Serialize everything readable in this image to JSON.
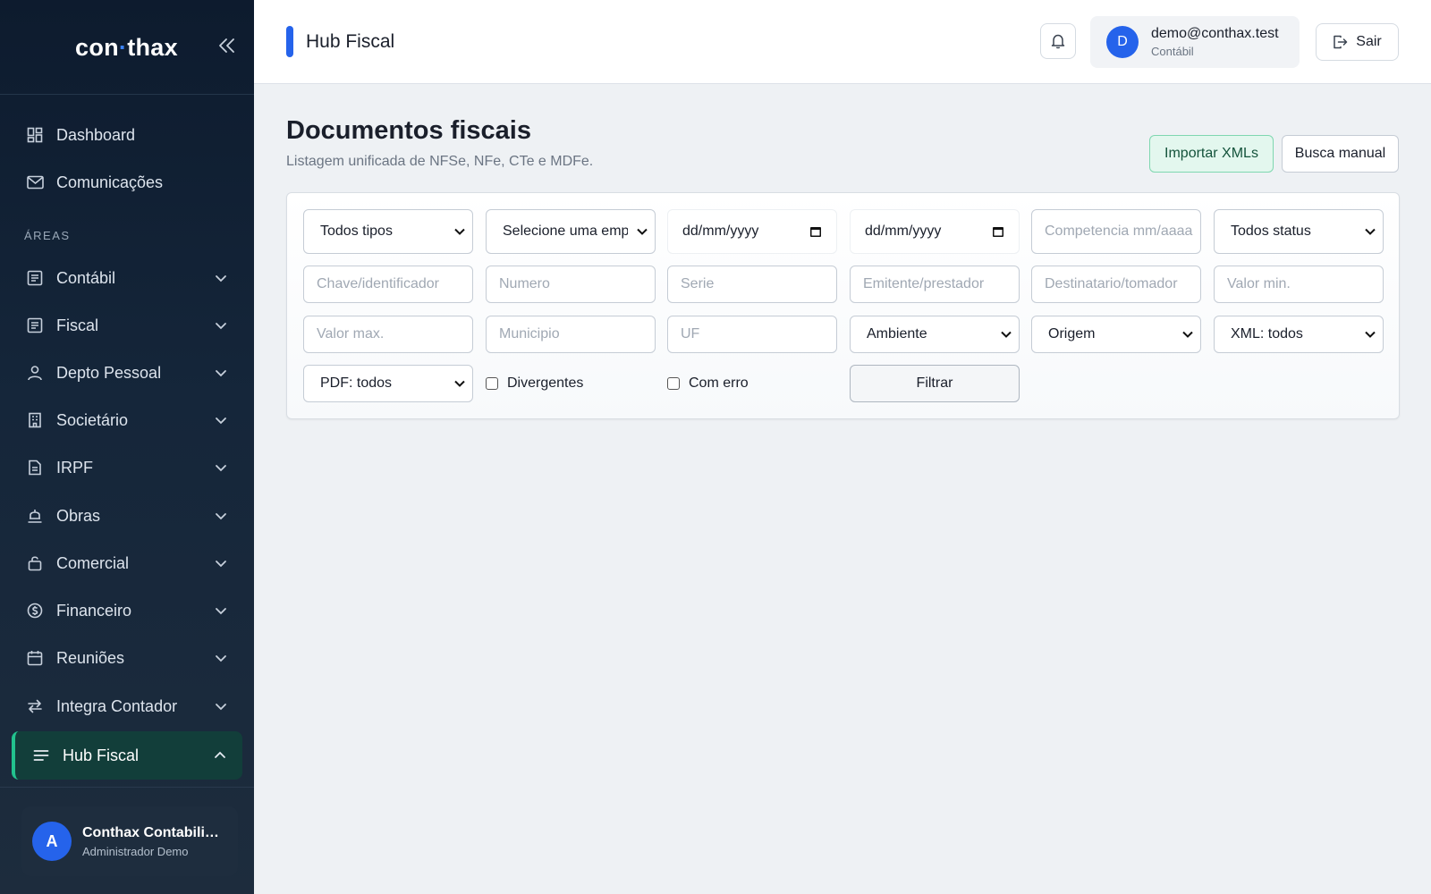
{
  "sidebar": {
    "brand": {
      "part1": "con",
      "dot": "·",
      "part2": "thax"
    },
    "top_items": [
      {
        "label": "Dashboard",
        "icon": "dashboard-icon"
      },
      {
        "label": "Comunicações",
        "icon": "mail-icon"
      }
    ],
    "section_label": "ÁREAS",
    "areas": [
      {
        "label": "Contábil",
        "icon": "ledger-icon"
      },
      {
        "label": "Fiscal",
        "icon": "ledger-icon"
      },
      {
        "label": "Depto Pessoal",
        "icon": "user-icon"
      },
      {
        "label": "Societário",
        "icon": "building-icon"
      },
      {
        "label": "IRPF",
        "icon": "document-icon"
      },
      {
        "label": "Obras",
        "icon": "construction-icon"
      },
      {
        "label": "Comercial",
        "icon": "bag-icon"
      },
      {
        "label": "Financeiro",
        "icon": "coin-icon"
      },
      {
        "label": "Reuniões",
        "icon": "calendar-icon"
      },
      {
        "label": "Integra Contador",
        "icon": "swap-icon"
      }
    ],
    "active_item": {
      "label": "Hub Fiscal",
      "icon": "list-icon"
    },
    "user": {
      "initial": "A",
      "name": "Conthax Contabilidade",
      "role": "Administrador Demo"
    }
  },
  "header": {
    "title": "Hub Fiscal",
    "user": {
      "initial": "D",
      "email": "demo@conthax.test",
      "role": "Contábil"
    },
    "logout_label": "Sair"
  },
  "page": {
    "title": "Documentos fiscais",
    "subtitle": "Listagem unificada de NFSe, NFe, CTe e MDFe.",
    "import_label": "Importar XMLs",
    "manual_label": "Busca manual"
  },
  "filters": {
    "tipo": "Todos tipos",
    "empresa": "Selecione uma empresa",
    "date_from": "dd/mm/yyyy",
    "date_to": "dd/mm/yyyy",
    "competencia_ph": "Competencia mm/aaaa",
    "status": "Todos status",
    "chave_ph": "Chave/identificador",
    "numero_ph": "Numero",
    "serie_ph": "Serie",
    "emitente_ph": "Emitente/prestador",
    "destinatario_ph": "Destinatario/tomador",
    "valor_min_ph": "Valor min.",
    "valor_max_ph": "Valor max.",
    "municipio_ph": "Municipio",
    "uf_ph": "UF",
    "ambiente": "Ambiente",
    "origem": "Origem",
    "xml": "XML: todos",
    "pdf": "PDF: todos",
    "divergentes_label": "Divergentes",
    "com_erro_label": "Com erro",
    "filtrar_label": "Filtrar"
  },
  "colors": {
    "accent": "#2563eb",
    "active_green": "#22c38e",
    "sidebar_bg": "#0d1b2e"
  }
}
